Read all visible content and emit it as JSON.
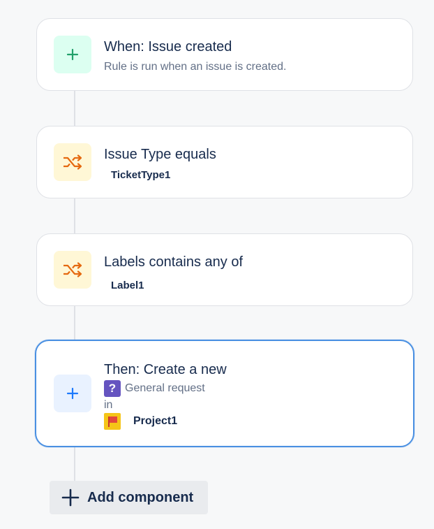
{
  "components": {
    "trigger": {
      "title": "When: Issue created",
      "description": "Rule is run when an issue is created.",
      "icon": "plus-icon",
      "icon_color": "#22a06b"
    },
    "condition_issue_type": {
      "title": "Issue Type equals",
      "value": "TicketType1",
      "icon": "shuffle-icon",
      "icon_color": "#e56910"
    },
    "condition_labels": {
      "title": "Labels contains any of",
      "value": "Label1",
      "icon": "shuffle-icon",
      "icon_color": "#e56910"
    },
    "action": {
      "title": "Then: Create a new",
      "issue_type": "General request",
      "issue_type_icon": "question-icon",
      "in_label": "in",
      "project": "Project1",
      "project_icon": "project-avatar-icon",
      "icon": "plus-icon",
      "icon_color": "#1d7afc",
      "selected": true
    }
  },
  "add_component": {
    "label": "Add component",
    "icon": "plus-icon"
  },
  "q_glyph": "?"
}
